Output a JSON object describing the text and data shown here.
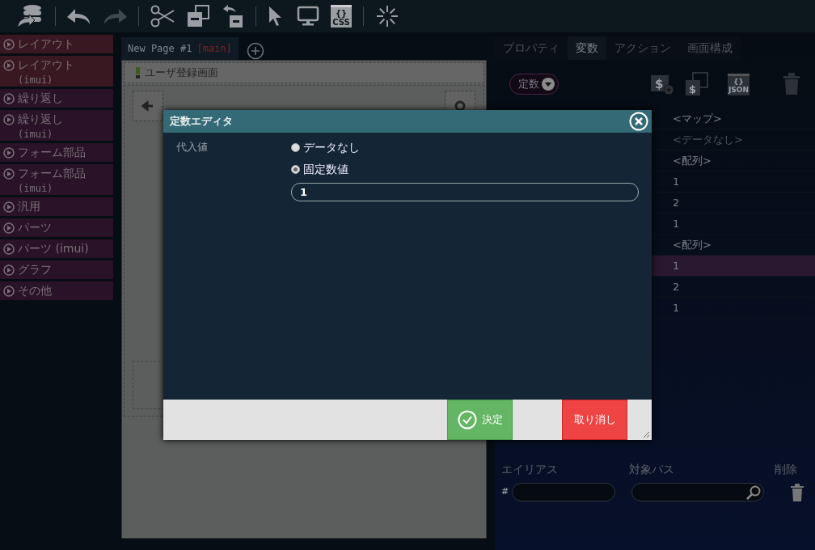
{
  "toolbar": [
    {
      "kind": "database",
      "disabled": false
    },
    {
      "kind": "sep"
    },
    {
      "kind": "undo",
      "disabled": false
    },
    {
      "kind": "redo",
      "disabled": true
    },
    {
      "kind": "sep"
    },
    {
      "kind": "scissors",
      "disabled": false
    },
    {
      "kind": "paste",
      "disabled": false
    },
    {
      "kind": "import",
      "disabled": false
    },
    {
      "kind": "sep"
    },
    {
      "kind": "cursor",
      "disabled": false
    },
    {
      "kind": "monitor",
      "disabled": false
    },
    {
      "kind": "css",
      "disabled": false,
      "label": "CSS",
      "sublabel": "{}"
    },
    {
      "kind": "sep"
    },
    {
      "kind": "spinner",
      "disabled": false
    }
  ],
  "palette": [
    {
      "label": "レイアウト",
      "color": "#3a1822"
    },
    {
      "label": "レイアウト",
      "sub": "(imui)",
      "color": "#3a1822"
    },
    {
      "label": "繰り返し",
      "color": "#2a1228"
    },
    {
      "label": "繰り返し",
      "sub": "(imui)",
      "color": "#2a1228"
    },
    {
      "label": "フォーム部品",
      "color": "#2a1228"
    },
    {
      "label": "フォーム部品",
      "sub": "(imui)",
      "color": "#2a1228"
    },
    {
      "label": "汎用",
      "color": "#2a1228"
    },
    {
      "label": "パーツ",
      "color": "#2a1228"
    },
    {
      "label": "パーツ (imui)",
      "color": "#2a1228"
    },
    {
      "label": "グラフ",
      "color": "#2a1228"
    },
    {
      "label": "その他",
      "color": "#2a1228"
    }
  ],
  "page_tab": {
    "title": "New Page #1",
    "branch": "[main]"
  },
  "canvas": {
    "screen_title": "ユーザ登録画面"
  },
  "right_tabs": [
    {
      "label": "プロパティ",
      "selected": false
    },
    {
      "label": "変数",
      "selected": true
    },
    {
      "label": "アクション",
      "selected": false
    },
    {
      "label": "画面構成",
      "selected": false
    }
  ],
  "variable_type": "定数",
  "variable_tools": [
    {
      "kind": "add",
      "label": "$"
    },
    {
      "kind": "copy",
      "label": "$"
    },
    {
      "kind": "json",
      "label": "JSON",
      "sublabel": "{}"
    },
    {
      "kind": "trash"
    }
  ],
  "values": [
    {
      "text": "<マップ>",
      "selected": false,
      "muted": false
    },
    {
      "text": "<データなし>",
      "selected": false,
      "muted": true
    },
    {
      "text": "<配列>",
      "selected": false,
      "muted": false
    },
    {
      "text": "1",
      "selected": false,
      "muted": false
    },
    {
      "text": "2",
      "selected": false,
      "muted": false
    },
    {
      "text": "1",
      "selected": false,
      "muted": false
    },
    {
      "text": "<配列>",
      "selected": false,
      "muted": false
    },
    {
      "text": "1",
      "selected": true,
      "muted": false
    },
    {
      "text": "2",
      "selected": false,
      "muted": false
    },
    {
      "text": "1",
      "selected": false,
      "muted": false
    }
  ],
  "alias_section": {
    "columns": [
      "エイリアス",
      "対象パス",
      "削除"
    ],
    "prefix": "#"
  },
  "dialog": {
    "title": "定数エディタ",
    "field_label": "代入値",
    "options": [
      {
        "label": "データなし",
        "selected": false
      },
      {
        "label": "固定数値",
        "selected": true
      }
    ],
    "value": "1",
    "ok": "決定",
    "cancel": "取り消し"
  }
}
